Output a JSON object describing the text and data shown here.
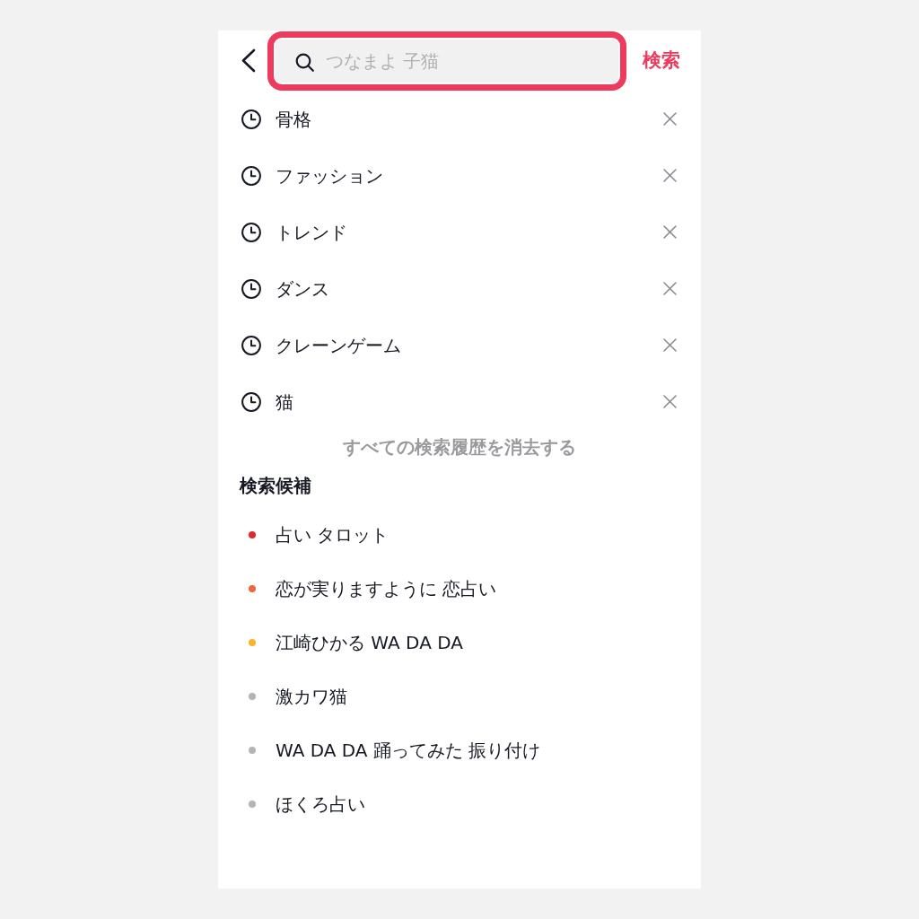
{
  "search": {
    "placeholder": "つなまよ 子猫",
    "highlighted": true
  },
  "search_button": "検索",
  "history": [
    {
      "label": "骨格"
    },
    {
      "label": "ファッション"
    },
    {
      "label": "トレンド"
    },
    {
      "label": "ダンス"
    },
    {
      "label": "クレーンゲーム"
    },
    {
      "label": "猫"
    }
  ],
  "clear_history": "すべての検索履歴を消去する",
  "suggestions_title": "検索候補",
  "suggestions": [
    {
      "label": "占い タロット",
      "color": "#e02a32"
    },
    {
      "label": "恋が実りますように 恋占い",
      "color": "#f0673a"
    },
    {
      "label": "江崎ひかる WA DA DA",
      "color": "#f9b428"
    },
    {
      "label": "激カワ猫",
      "color": "#b5b5b5"
    },
    {
      "label": "WA DA DA 踊ってみた 振り付け",
      "color": "#b5b5b5"
    },
    {
      "label": "ほくろ占い",
      "color": "#b5b5b5"
    }
  ]
}
